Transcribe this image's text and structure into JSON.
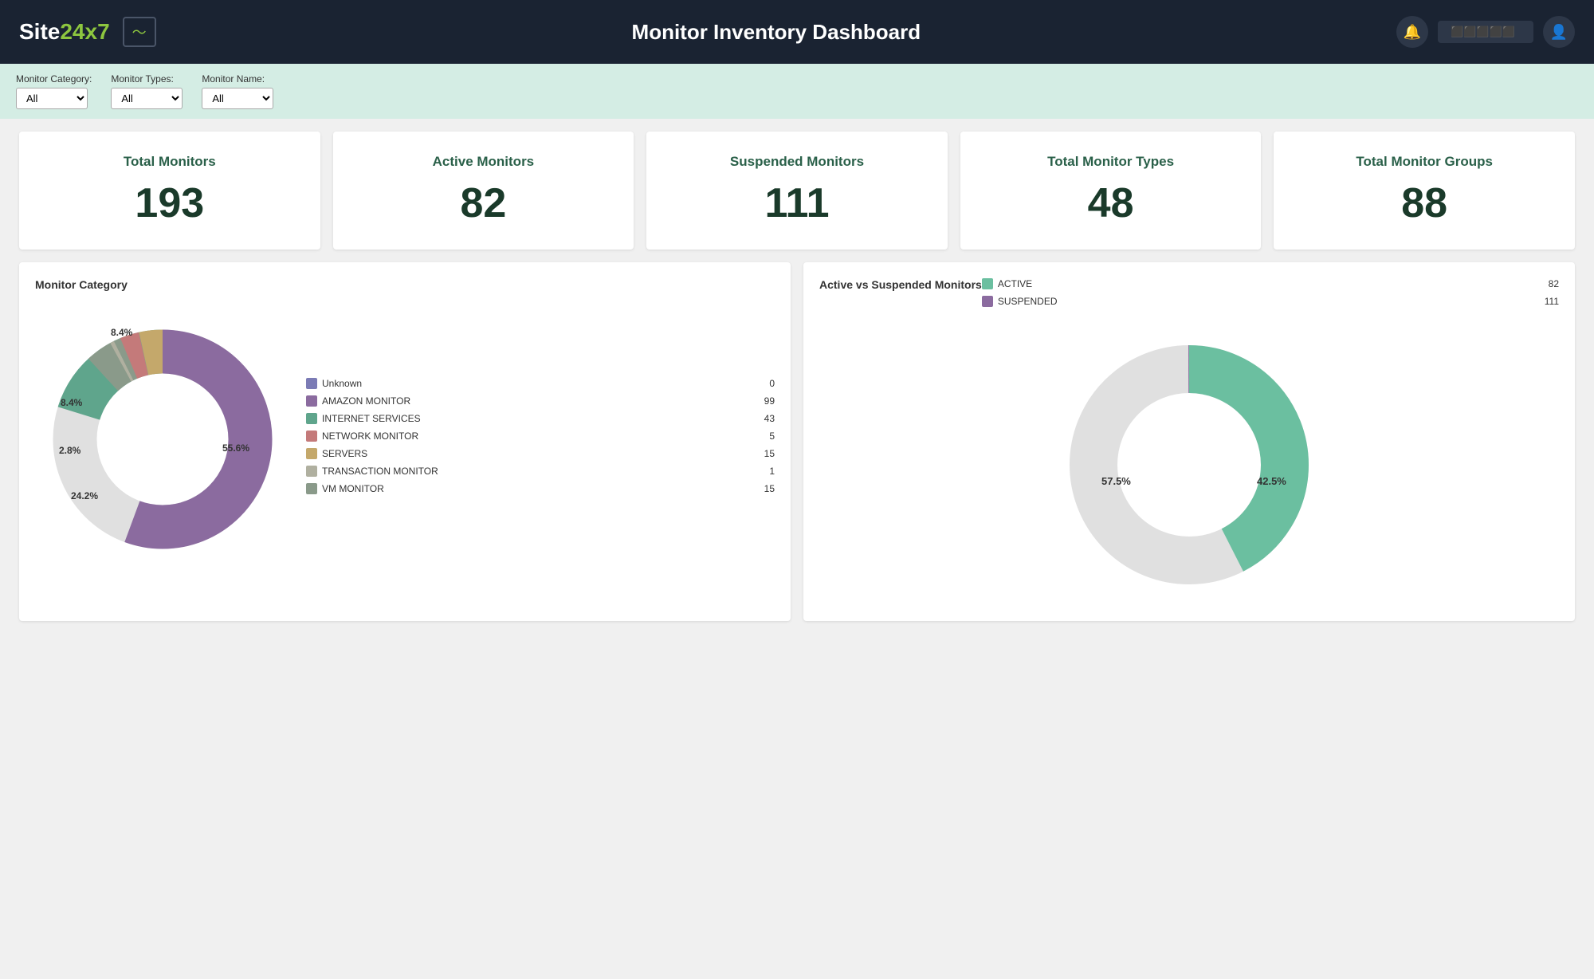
{
  "header": {
    "logo_site": "Site",
    "logo_247": "24x7",
    "title": "Monitor Inventory Dashboard"
  },
  "filters": {
    "category_label": "Monitor Category:",
    "category_options": [
      "All"
    ],
    "category_selected": "All",
    "types_label": "Monitor Types:",
    "types_options": [
      "All"
    ],
    "types_selected": "All",
    "name_label": "Monitor Name:",
    "name_options": [
      "All"
    ],
    "name_selected": "All"
  },
  "stats": [
    {
      "title": "Total Monitors",
      "value": "193"
    },
    {
      "title": "Active Monitors",
      "value": "82"
    },
    {
      "title": "Suspended Monitors",
      "value": "111"
    },
    {
      "title": "Total Monitor Types",
      "value": "48"
    },
    {
      "title": "Total Monitor Groups",
      "value": "88"
    }
  ],
  "chart_category": {
    "title": "Monitor Category",
    "segments": [
      {
        "label": "Unknown",
        "value": 0,
        "percent": 0,
        "color": "#7b7bb5"
      },
      {
        "label": "AMAZON MONITOR",
        "value": 99,
        "percent": 55.6,
        "color": "#8b6b9f"
      },
      {
        "label": "INTERNET SERVICES",
        "value": 43,
        "percent": 24.2,
        "color": "#5fa58c"
      },
      {
        "label": "NETWORK MONITOR",
        "value": 5,
        "percent": 2.8,
        "color": "#c47a7a"
      },
      {
        "label": "SERVERS",
        "value": 15,
        "percent": 8.4,
        "color": "#c4a86b"
      },
      {
        "label": "TRANSACTION MONITOR",
        "value": 1,
        "percent": 0.6,
        "color": "#b0b0a0"
      },
      {
        "label": "VM MONITOR",
        "value": 15,
        "percent": 8.4,
        "color": "#8a9a8a"
      }
    ],
    "labels_on_chart": [
      {
        "text": "55.6%",
        "x": "62%",
        "y": "56%"
      },
      {
        "text": "24.2%",
        "x": "10%",
        "y": "76%"
      },
      {
        "text": "8.4%",
        "x": "5%",
        "y": "34%"
      },
      {
        "text": "8.4%",
        "x": "30%",
        "y": "8%"
      },
      {
        "text": "2.8%",
        "x": "8%",
        "y": "57%"
      }
    ]
  },
  "chart_active_suspended": {
    "title": "Active vs Suspended Monitors",
    "segments": [
      {
        "label": "ACTIVE",
        "value": 82,
        "percent": 42.5,
        "color": "#6bbfa0"
      },
      {
        "label": "SUSPENDED",
        "value": 111,
        "percent": 57.5,
        "color": "#8b6b9f"
      }
    ],
    "labels_on_chart": [
      {
        "text": "42.5%",
        "x": "72%",
        "y": "62%"
      },
      {
        "text": "57.5%",
        "x": "22%",
        "y": "62%"
      }
    ]
  }
}
